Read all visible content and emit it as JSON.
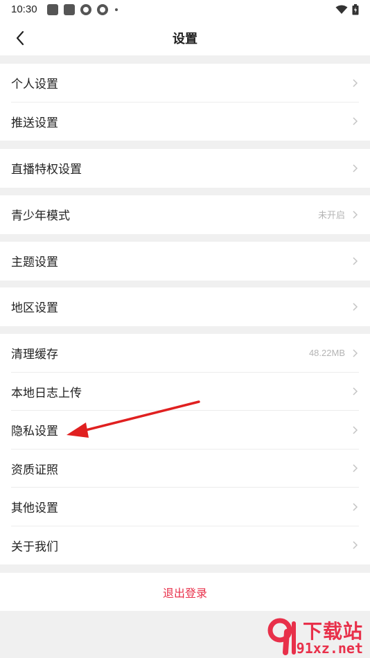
{
  "status_bar": {
    "time": "10:30"
  },
  "header": {
    "title": "设置"
  },
  "groups": [
    [
      {
        "label": "个人设置"
      },
      {
        "label": "推送设置"
      }
    ],
    [
      {
        "label": "直播特权设置"
      }
    ],
    [
      {
        "label": "青少年模式",
        "value": "未开启"
      }
    ],
    [
      {
        "label": "主题设置"
      }
    ],
    [
      {
        "label": "地区设置"
      }
    ],
    [
      {
        "label": "清理缓存",
        "value": "48.22MB"
      },
      {
        "label": "本地日志上传"
      },
      {
        "label": "隐私设置"
      },
      {
        "label": "资质证照"
      },
      {
        "label": "其他设置"
      },
      {
        "label": "关于我们"
      }
    ]
  ],
  "logout_label": "退出登录",
  "watermark": {
    "top": "下载站",
    "bottom": "91xz.net"
  },
  "colors": {
    "accent": "#e8304a",
    "background": "#f0f0f0",
    "annotation_arrow": "#e02020"
  },
  "icons": {
    "back": "chevron-left-icon",
    "row_arrow": "chevron-right-icon"
  }
}
